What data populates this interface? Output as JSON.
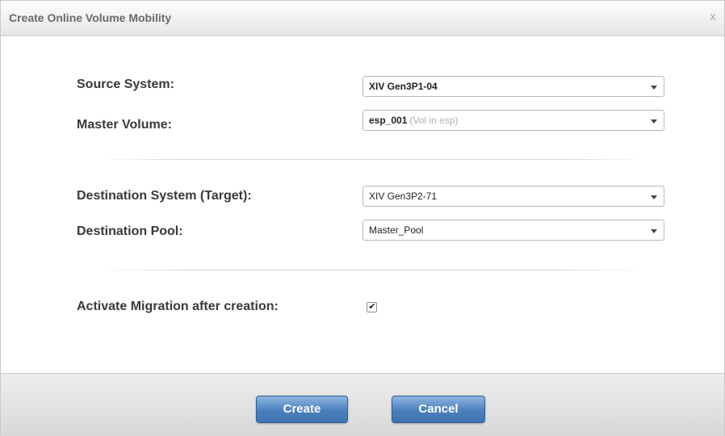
{
  "dialog": {
    "title": "Create Online Volume Mobility",
    "close_label": "x"
  },
  "form": {
    "source_system": {
      "label": "Source System:",
      "value": "XIV Gen3P1-04"
    },
    "master_volume": {
      "label": "Master Volume:",
      "value": "esp_001",
      "hint": "(Vol in esp)"
    },
    "destination_system": {
      "label": "Destination System (Target):",
      "value": "XIV Gen3P2-71"
    },
    "destination_pool": {
      "label": "Destination Pool:",
      "value": "Master_Pool"
    },
    "activate_migration": {
      "label": "Activate Migration after creation:",
      "checked": true
    }
  },
  "buttons": {
    "create_label": "Create",
    "cancel_label": "Cancel"
  },
  "colors": {
    "button_blue": "#4a7fbd",
    "label_text": "#3a3a3a",
    "hint_text": "#b0b0b0"
  }
}
